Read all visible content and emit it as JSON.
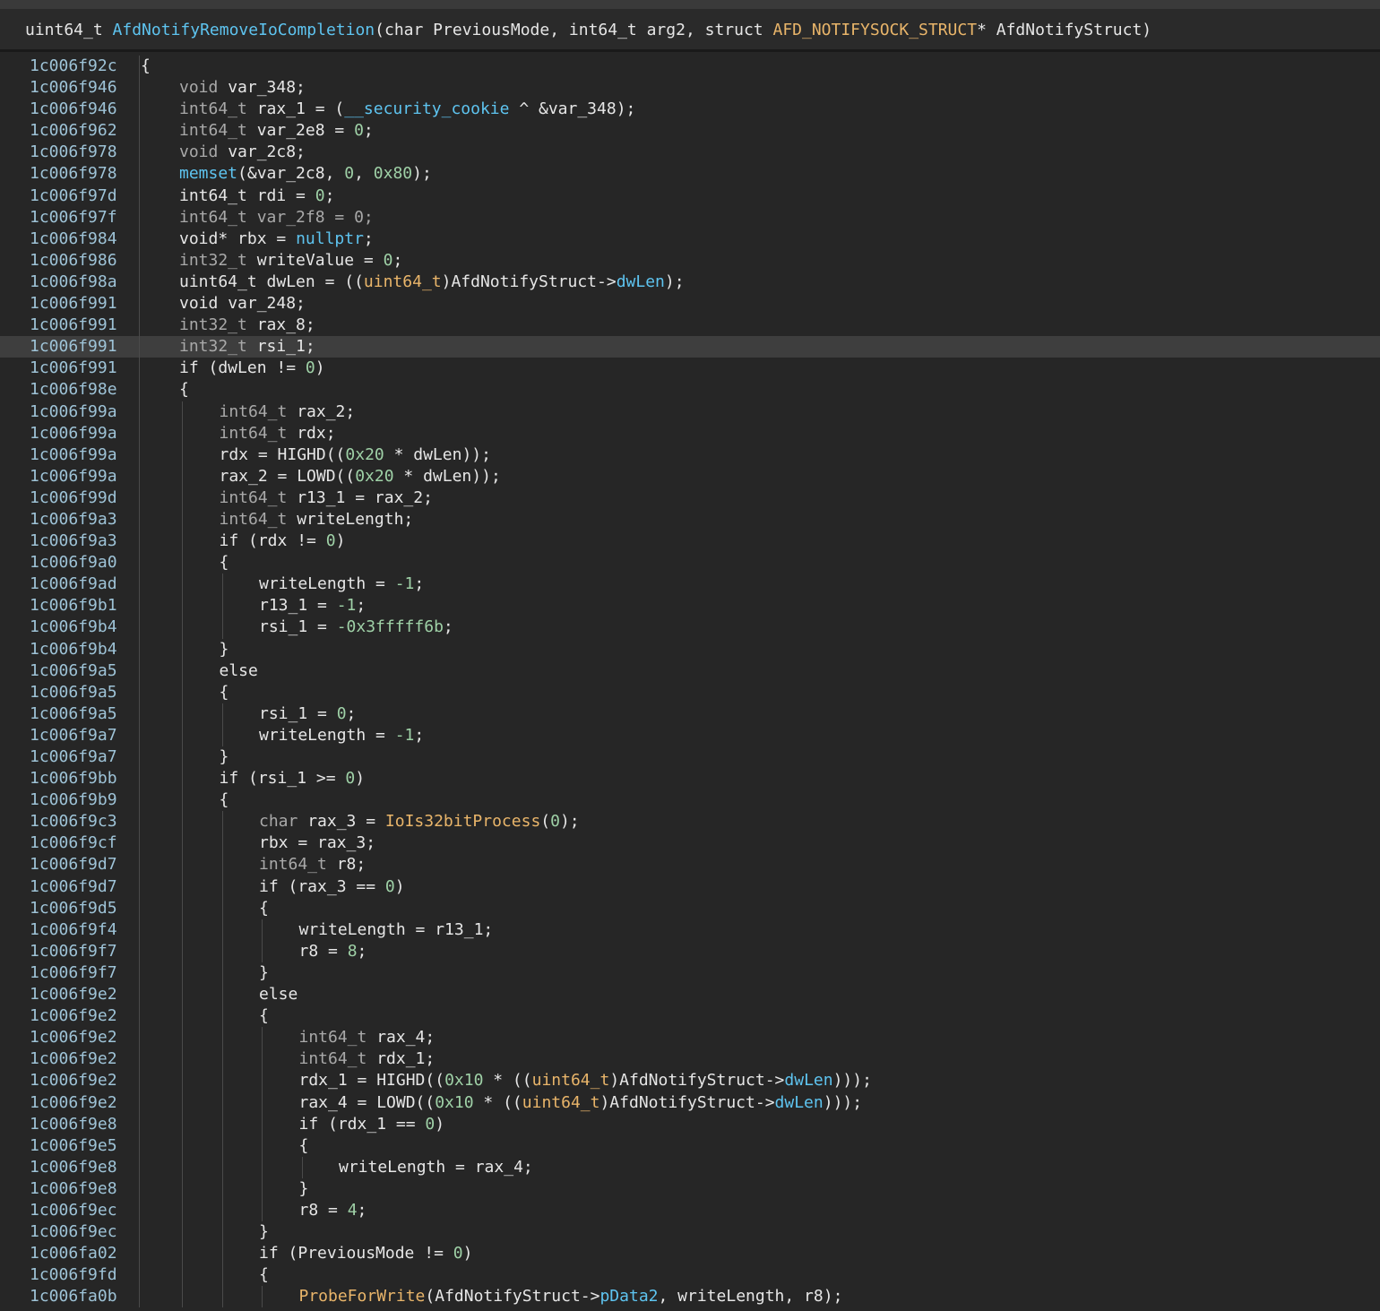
{
  "header": {
    "tokens": [
      {
        "t": "uint64_t ",
        "c": "plain"
      },
      {
        "t": "AfdNotifyRemoveIoCompletion",
        "c": "fn"
      },
      {
        "t": "(char PreviousMode, int64_t arg2, struct ",
        "c": "plain"
      },
      {
        "t": "AFD_NOTIFYSOCK_STRUCT",
        "c": "imp"
      },
      {
        "t": "* AfdNotifyStruct)",
        "c": "plain"
      }
    ]
  },
  "colors": {
    "background": "#262626",
    "address": "#9ec3d7",
    "function": "#5ec4f0",
    "import": "#e9b56a",
    "number": "#9fd1a7",
    "type": "#a9a9a9",
    "highlight": "#3e3e3e"
  },
  "highlighted_line": 13,
  "lines": [
    {
      "addr": "1c006f92c",
      "indent": 0,
      "tokens": [
        {
          "t": "{",
          "c": "plain"
        }
      ]
    },
    {
      "addr": "1c006f946",
      "indent": 1,
      "tokens": [
        {
          "t": "void ",
          "c": "type"
        },
        {
          "t": "var_348;",
          "c": "plain"
        }
      ]
    },
    {
      "addr": "1c006f946",
      "indent": 1,
      "tokens": [
        {
          "t": "int64_t ",
          "c": "type"
        },
        {
          "t": "rax_1 = (",
          "c": "plain"
        },
        {
          "t": "__security_cookie",
          "c": "fn"
        },
        {
          "t": " ^ &var_348);",
          "c": "plain"
        }
      ]
    },
    {
      "addr": "1c006f962",
      "indent": 1,
      "tokens": [
        {
          "t": "int64_t ",
          "c": "type"
        },
        {
          "t": "var_2e8 = ",
          "c": "plain"
        },
        {
          "t": "0",
          "c": "num"
        },
        {
          "t": ";",
          "c": "plain"
        }
      ]
    },
    {
      "addr": "1c006f978",
      "indent": 1,
      "tokens": [
        {
          "t": "void ",
          "c": "type"
        },
        {
          "t": "var_2c8;",
          "c": "plain"
        }
      ]
    },
    {
      "addr": "1c006f978",
      "indent": 1,
      "tokens": [
        {
          "t": "memset",
          "c": "fn"
        },
        {
          "t": "(&var_2c8, ",
          "c": "plain"
        },
        {
          "t": "0",
          "c": "num"
        },
        {
          "t": ", ",
          "c": "plain"
        },
        {
          "t": "0x80",
          "c": "num"
        },
        {
          "t": ");",
          "c": "plain"
        }
      ]
    },
    {
      "addr": "1c006f97d",
      "indent": 1,
      "tokens": [
        {
          "t": "int64_t ",
          "c": "plain"
        },
        {
          "t": "rdi = ",
          "c": "plain"
        },
        {
          "t": "0",
          "c": "num"
        },
        {
          "t": ";",
          "c": "plain"
        }
      ]
    },
    {
      "addr": "1c006f97f",
      "indent": 1,
      "tokens": [
        {
          "t": "int64_t ",
          "c": "type"
        },
        {
          "t": "var_2f8 = 0;",
          "c": "type"
        }
      ]
    },
    {
      "addr": "1c006f984",
      "indent": 1,
      "tokens": [
        {
          "t": "void* ",
          "c": "plain"
        },
        {
          "t": "rbx = ",
          "c": "plain"
        },
        {
          "t": "nullptr",
          "c": "fn"
        },
        {
          "t": ";",
          "c": "plain"
        }
      ]
    },
    {
      "addr": "1c006f986",
      "indent": 1,
      "tokens": [
        {
          "t": "int32_t ",
          "c": "type"
        },
        {
          "t": "writeValue = ",
          "c": "plain"
        },
        {
          "t": "0",
          "c": "num"
        },
        {
          "t": ";",
          "c": "plain"
        }
      ]
    },
    {
      "addr": "1c006f98a",
      "indent": 1,
      "tokens": [
        {
          "t": "uint64_t ",
          "c": "plain"
        },
        {
          "t": "dwLen = ((",
          "c": "plain"
        },
        {
          "t": "uint64_t",
          "c": "imp"
        },
        {
          "t": ")AfdNotifyStruct->",
          "c": "plain"
        },
        {
          "t": "dwLen",
          "c": "field"
        },
        {
          "t": ");",
          "c": "plain"
        }
      ]
    },
    {
      "addr": "1c006f991",
      "indent": 1,
      "tokens": [
        {
          "t": "void ",
          "c": "plain"
        },
        {
          "t": "var_248;",
          "c": "plain"
        }
      ]
    },
    {
      "addr": "1c006f991",
      "indent": 1,
      "tokens": [
        {
          "t": "int32_t ",
          "c": "type"
        },
        {
          "t": "rax_8;",
          "c": "plain"
        }
      ]
    },
    {
      "addr": "1c006f991",
      "indent": 1,
      "tokens": [
        {
          "t": "int32_t ",
          "c": "type"
        },
        {
          "t": "rsi_1;",
          "c": "plain"
        }
      ]
    },
    {
      "addr": "1c006f991",
      "indent": 1,
      "tokens": [
        {
          "t": "if (dwLen != ",
          "c": "plain"
        },
        {
          "t": "0",
          "c": "num"
        },
        {
          "t": ")",
          "c": "plain"
        }
      ]
    },
    {
      "addr": "1c006f98e",
      "indent": 1,
      "tokens": [
        {
          "t": "{",
          "c": "plain"
        }
      ]
    },
    {
      "addr": "1c006f99a",
      "indent": 2,
      "tokens": [
        {
          "t": "int64_t ",
          "c": "type"
        },
        {
          "t": "rax_2;",
          "c": "plain"
        }
      ]
    },
    {
      "addr": "1c006f99a",
      "indent": 2,
      "tokens": [
        {
          "t": "int64_t ",
          "c": "type"
        },
        {
          "t": "rdx;",
          "c": "plain"
        }
      ]
    },
    {
      "addr": "1c006f99a",
      "indent": 2,
      "tokens": [
        {
          "t": "rdx = HIGHD((",
          "c": "plain"
        },
        {
          "t": "0x20",
          "c": "num"
        },
        {
          "t": " * dwLen));",
          "c": "plain"
        }
      ]
    },
    {
      "addr": "1c006f99a",
      "indent": 2,
      "tokens": [
        {
          "t": "rax_2 = LOWD((",
          "c": "plain"
        },
        {
          "t": "0x20",
          "c": "num"
        },
        {
          "t": " * dwLen));",
          "c": "plain"
        }
      ]
    },
    {
      "addr": "1c006f99d",
      "indent": 2,
      "tokens": [
        {
          "t": "int64_t ",
          "c": "type"
        },
        {
          "t": "r13_1 = rax_2;",
          "c": "plain"
        }
      ]
    },
    {
      "addr": "1c006f9a3",
      "indent": 2,
      "tokens": [
        {
          "t": "int64_t ",
          "c": "type"
        },
        {
          "t": "writeLength;",
          "c": "plain"
        }
      ]
    },
    {
      "addr": "1c006f9a3",
      "indent": 2,
      "tokens": [
        {
          "t": "if (rdx != ",
          "c": "plain"
        },
        {
          "t": "0",
          "c": "num"
        },
        {
          "t": ")",
          "c": "plain"
        }
      ]
    },
    {
      "addr": "1c006f9a0",
      "indent": 2,
      "tokens": [
        {
          "t": "{",
          "c": "plain"
        }
      ]
    },
    {
      "addr": "1c006f9ad",
      "indent": 3,
      "tokens": [
        {
          "t": "writeLength = ",
          "c": "plain"
        },
        {
          "t": "-1",
          "c": "num"
        },
        {
          "t": ";",
          "c": "plain"
        }
      ]
    },
    {
      "addr": "1c006f9b1",
      "indent": 3,
      "tokens": [
        {
          "t": "r13_1 = ",
          "c": "plain"
        },
        {
          "t": "-1",
          "c": "num"
        },
        {
          "t": ";",
          "c": "plain"
        }
      ]
    },
    {
      "addr": "1c006f9b4",
      "indent": 3,
      "tokens": [
        {
          "t": "rsi_1 = ",
          "c": "plain"
        },
        {
          "t": "-0x3fffff6b",
          "c": "num"
        },
        {
          "t": ";",
          "c": "plain"
        }
      ]
    },
    {
      "addr": "1c006f9b4",
      "indent": 2,
      "tokens": [
        {
          "t": "}",
          "c": "plain"
        }
      ]
    },
    {
      "addr": "1c006f9a5",
      "indent": 2,
      "tokens": [
        {
          "t": "else",
          "c": "plain"
        }
      ]
    },
    {
      "addr": "1c006f9a5",
      "indent": 2,
      "tokens": [
        {
          "t": "{",
          "c": "plain"
        }
      ]
    },
    {
      "addr": "1c006f9a5",
      "indent": 3,
      "tokens": [
        {
          "t": "rsi_1 = ",
          "c": "plain"
        },
        {
          "t": "0",
          "c": "num"
        },
        {
          "t": ";",
          "c": "plain"
        }
      ]
    },
    {
      "addr": "1c006f9a7",
      "indent": 3,
      "tokens": [
        {
          "t": "writeLength = ",
          "c": "plain"
        },
        {
          "t": "-1",
          "c": "num"
        },
        {
          "t": ";",
          "c": "plain"
        }
      ]
    },
    {
      "addr": "1c006f9a7",
      "indent": 2,
      "tokens": [
        {
          "t": "}",
          "c": "plain"
        }
      ]
    },
    {
      "addr": "1c006f9bb",
      "indent": 2,
      "tokens": [
        {
          "t": "if (rsi_1 >= ",
          "c": "plain"
        },
        {
          "t": "0",
          "c": "num"
        },
        {
          "t": ")",
          "c": "plain"
        }
      ]
    },
    {
      "addr": "1c006f9b9",
      "indent": 2,
      "tokens": [
        {
          "t": "{",
          "c": "plain"
        }
      ]
    },
    {
      "addr": "1c006f9c3",
      "indent": 3,
      "tokens": [
        {
          "t": "char ",
          "c": "type"
        },
        {
          "t": "rax_3 = ",
          "c": "plain"
        },
        {
          "t": "IoIs32bitProcess",
          "c": "imp"
        },
        {
          "t": "(",
          "c": "plain"
        },
        {
          "t": "0",
          "c": "num"
        },
        {
          "t": ");",
          "c": "plain"
        }
      ]
    },
    {
      "addr": "1c006f9cf",
      "indent": 3,
      "tokens": [
        {
          "t": "rbx = rax_3;",
          "c": "plain"
        }
      ]
    },
    {
      "addr": "1c006f9d7",
      "indent": 3,
      "tokens": [
        {
          "t": "int64_t ",
          "c": "type"
        },
        {
          "t": "r8;",
          "c": "plain"
        }
      ]
    },
    {
      "addr": "1c006f9d7",
      "indent": 3,
      "tokens": [
        {
          "t": "if (rax_3 == ",
          "c": "plain"
        },
        {
          "t": "0",
          "c": "num"
        },
        {
          "t": ")",
          "c": "plain"
        }
      ]
    },
    {
      "addr": "1c006f9d5",
      "indent": 3,
      "tokens": [
        {
          "t": "{",
          "c": "plain"
        }
      ]
    },
    {
      "addr": "1c006f9f4",
      "indent": 4,
      "tokens": [
        {
          "t": "writeLength = r13_1;",
          "c": "plain"
        }
      ]
    },
    {
      "addr": "1c006f9f7",
      "indent": 4,
      "tokens": [
        {
          "t": "r8 = ",
          "c": "plain"
        },
        {
          "t": "8",
          "c": "num"
        },
        {
          "t": ";",
          "c": "plain"
        }
      ]
    },
    {
      "addr": "1c006f9f7",
      "indent": 3,
      "tokens": [
        {
          "t": "}",
          "c": "plain"
        }
      ]
    },
    {
      "addr": "1c006f9e2",
      "indent": 3,
      "tokens": [
        {
          "t": "else",
          "c": "plain"
        }
      ]
    },
    {
      "addr": "1c006f9e2",
      "indent": 3,
      "tokens": [
        {
          "t": "{",
          "c": "plain"
        }
      ]
    },
    {
      "addr": "1c006f9e2",
      "indent": 4,
      "tokens": [
        {
          "t": "int64_t ",
          "c": "type"
        },
        {
          "t": "rax_4;",
          "c": "plain"
        }
      ]
    },
    {
      "addr": "1c006f9e2",
      "indent": 4,
      "tokens": [
        {
          "t": "int64_t ",
          "c": "type"
        },
        {
          "t": "rdx_1;",
          "c": "plain"
        }
      ]
    },
    {
      "addr": "1c006f9e2",
      "indent": 4,
      "tokens": [
        {
          "t": "rdx_1 = HIGHD((",
          "c": "plain"
        },
        {
          "t": "0x10",
          "c": "num"
        },
        {
          "t": " * ((",
          "c": "plain"
        },
        {
          "t": "uint64_t",
          "c": "imp"
        },
        {
          "t": ")AfdNotifyStruct->",
          "c": "plain"
        },
        {
          "t": "dwLen",
          "c": "field"
        },
        {
          "t": ")));",
          "c": "plain"
        }
      ]
    },
    {
      "addr": "1c006f9e2",
      "indent": 4,
      "tokens": [
        {
          "t": "rax_4 = LOWD((",
          "c": "plain"
        },
        {
          "t": "0x10",
          "c": "num"
        },
        {
          "t": " * ((",
          "c": "plain"
        },
        {
          "t": "uint64_t",
          "c": "imp"
        },
        {
          "t": ")AfdNotifyStruct->",
          "c": "plain"
        },
        {
          "t": "dwLen",
          "c": "field"
        },
        {
          "t": ")));",
          "c": "plain"
        }
      ]
    },
    {
      "addr": "1c006f9e8",
      "indent": 4,
      "tokens": [
        {
          "t": "if (rdx_1 == ",
          "c": "plain"
        },
        {
          "t": "0",
          "c": "num"
        },
        {
          "t": ")",
          "c": "plain"
        }
      ]
    },
    {
      "addr": "1c006f9e5",
      "indent": 4,
      "tokens": [
        {
          "t": "{",
          "c": "plain"
        }
      ]
    },
    {
      "addr": "1c006f9e8",
      "indent": 5,
      "tokens": [
        {
          "t": "writeLength = rax_4;",
          "c": "plain"
        }
      ]
    },
    {
      "addr": "1c006f9e8",
      "indent": 4,
      "tokens": [
        {
          "t": "}",
          "c": "plain"
        }
      ]
    },
    {
      "addr": "1c006f9ec",
      "indent": 4,
      "tokens": [
        {
          "t": "r8 = ",
          "c": "plain"
        },
        {
          "t": "4",
          "c": "num"
        },
        {
          "t": ";",
          "c": "plain"
        }
      ]
    },
    {
      "addr": "1c006f9ec",
      "indent": 3,
      "tokens": [
        {
          "t": "}",
          "c": "plain"
        }
      ]
    },
    {
      "addr": "1c006fa02",
      "indent": 3,
      "tokens": [
        {
          "t": "if (PreviousMode != ",
          "c": "plain"
        },
        {
          "t": "0",
          "c": "num"
        },
        {
          "t": ")",
          "c": "plain"
        }
      ]
    },
    {
      "addr": "1c006f9fd",
      "indent": 3,
      "tokens": [
        {
          "t": "{",
          "c": "plain"
        }
      ]
    },
    {
      "addr": "1c006fa0b",
      "indent": 4,
      "tokens": [
        {
          "t": "ProbeForWrite",
          "c": "imp"
        },
        {
          "t": "(AfdNotifyStruct->",
          "c": "plain"
        },
        {
          "t": "pData2",
          "c": "field"
        },
        {
          "t": ", writeLength, r8);",
          "c": "plain"
        }
      ]
    }
  ]
}
